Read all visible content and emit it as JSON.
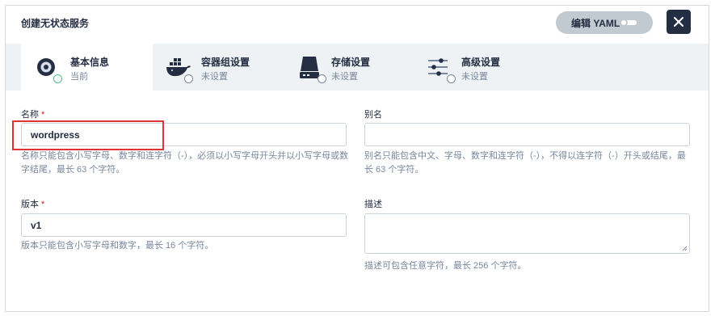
{
  "header": {
    "title": "创建无状态服务",
    "yaml_button_label": "编辑 YAML",
    "close_icon": "close-icon"
  },
  "steps": [
    {
      "title": "基本信息",
      "status": "当前",
      "icon": "info-disc-icon"
    },
    {
      "title": "容器组设置",
      "status": "未设置",
      "icon": "docker-whale-icon"
    },
    {
      "title": "存储设置",
      "status": "未设置",
      "icon": "storage-disk-icon"
    },
    {
      "title": "高级设置",
      "status": "未设置",
      "icon": "sliders-icon"
    }
  ],
  "form": {
    "name": {
      "label": "名称",
      "required_mark": "*",
      "value": "wordpress",
      "help_line1": "名称只能包含小写字母、数字和连字符（-），必须以小写字母开头并以小写字母或数",
      "help_line2": "字结尾，最长 63 个字符。"
    },
    "alias": {
      "label": "别名",
      "value": "",
      "help_line1": "别名只能包含中文、字母、数字和连字符（-），不得以连字符（-）开头或结尾，最",
      "help_line2": "长 63 个字符。"
    },
    "version": {
      "label": "版本",
      "required_mark": "*",
      "value": "v1",
      "help": "版本只能包含小写字母和数字，最长 16 个字符。"
    },
    "description": {
      "label": "描述",
      "value": "",
      "help": "描述可包含任意字符，最长 256 个字符。"
    }
  },
  "colors": {
    "brand_dark": "#242e42",
    "muted_text": "#79879c",
    "step_bar": "#eef2f5",
    "success": "#55bc8a",
    "required": "#ca2621",
    "annotation": "#e03434"
  }
}
